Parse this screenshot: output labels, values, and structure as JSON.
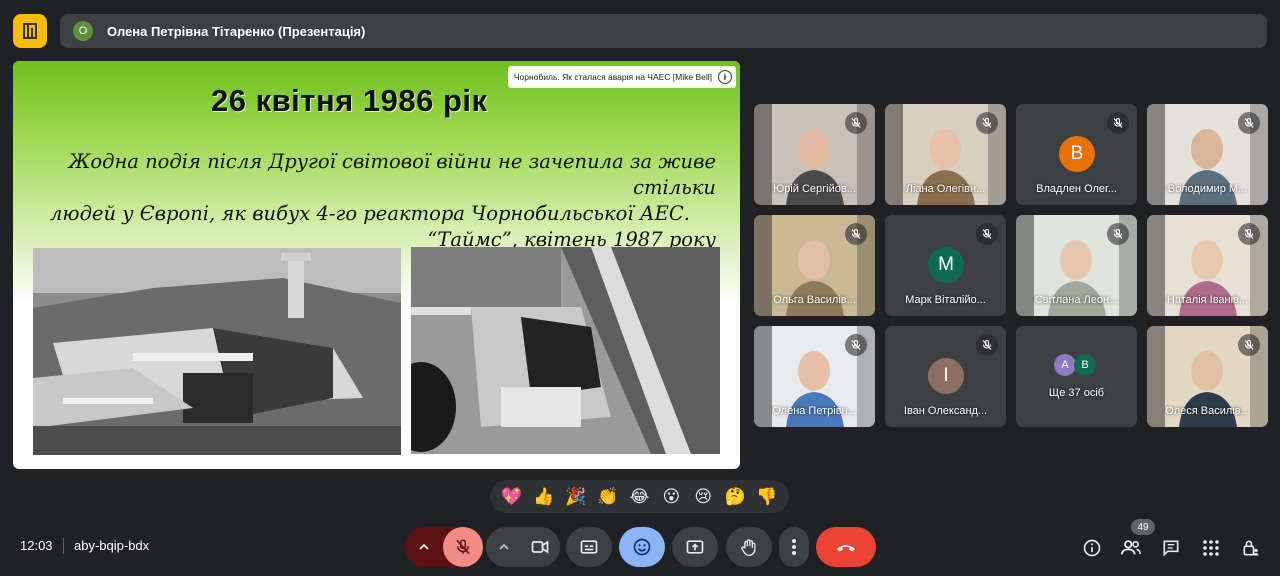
{
  "header": {
    "presenter_initial": "О",
    "title": "Олена Петрівна Тітаренко (Презентація)"
  },
  "slide": {
    "title": "26 квітня 1986 рік",
    "quote_lines": [
      "Жодна подія після Другої світової війни не зачепила за живе стільки",
      "людей у Європі, як вибух 4-го реактора Чорнобильської АЕС.",
      "“Таймс”, квітень 1987 року"
    ],
    "video_chip": "Чорнобиль. Як сталася аварія на ЧАЕС [Mike Bell]",
    "info_glyph": "i"
  },
  "participants": [
    {
      "name": "Юрій Сергійович",
      "display": "Юрій Сергійов...",
      "type": "video"
    },
    {
      "name": "Ліана Олегівна",
      "display": "Ліана Олегівн...",
      "type": "video"
    },
    {
      "name": "Владлен Олег...",
      "display": "Владлен Олег...",
      "type": "letter",
      "initial": "В",
      "color": "#e8710a"
    },
    {
      "name": "Володимир М...",
      "display": "Володимир М...",
      "type": "video"
    },
    {
      "name": "Ольга Василів...",
      "display": "Ольга Василів...",
      "type": "video"
    },
    {
      "name": "Марк Віталійо...",
      "display": "Марк Віталійо...",
      "type": "letter",
      "initial": "М",
      "color": "#0d6b4f"
    },
    {
      "name": "Світлана Леон...",
      "display": "Світлана Леон...",
      "type": "video"
    },
    {
      "name": "Наталія Іванів...",
      "display": "Наталія Іванів...",
      "type": "video"
    },
    {
      "name": "Олена Петрівн...",
      "display": "Олена Петрівн...",
      "type": "video"
    },
    {
      "name": "Іван Олександ...",
      "display": "Іван Олександ...",
      "type": "letter",
      "initial": "І",
      "color": "#8d6e63"
    },
    {
      "name": "Ще 37 осіб",
      "display": "Ще 37 осіб",
      "type": "more",
      "initials": [
        "А",
        "В"
      ]
    },
    {
      "name": "Олеся Василів...",
      "display": "Олеся Василів...",
      "type": "video"
    }
  ],
  "reactions": [
    "💖",
    "👍",
    "🎉",
    "👏",
    "😂",
    "😮",
    "😢",
    "🤔",
    "👎"
  ],
  "footer": {
    "time": "12:03",
    "meeting_code": "aby-bqip-bdx",
    "people_count": "49"
  },
  "colors": {
    "background": "#202124",
    "tile": "#3c4043",
    "accent_blue": "#8ab4f8",
    "mic_red": "#5c1212",
    "end_call": "#ea4335",
    "logo_yellow": "#fbbc04"
  }
}
